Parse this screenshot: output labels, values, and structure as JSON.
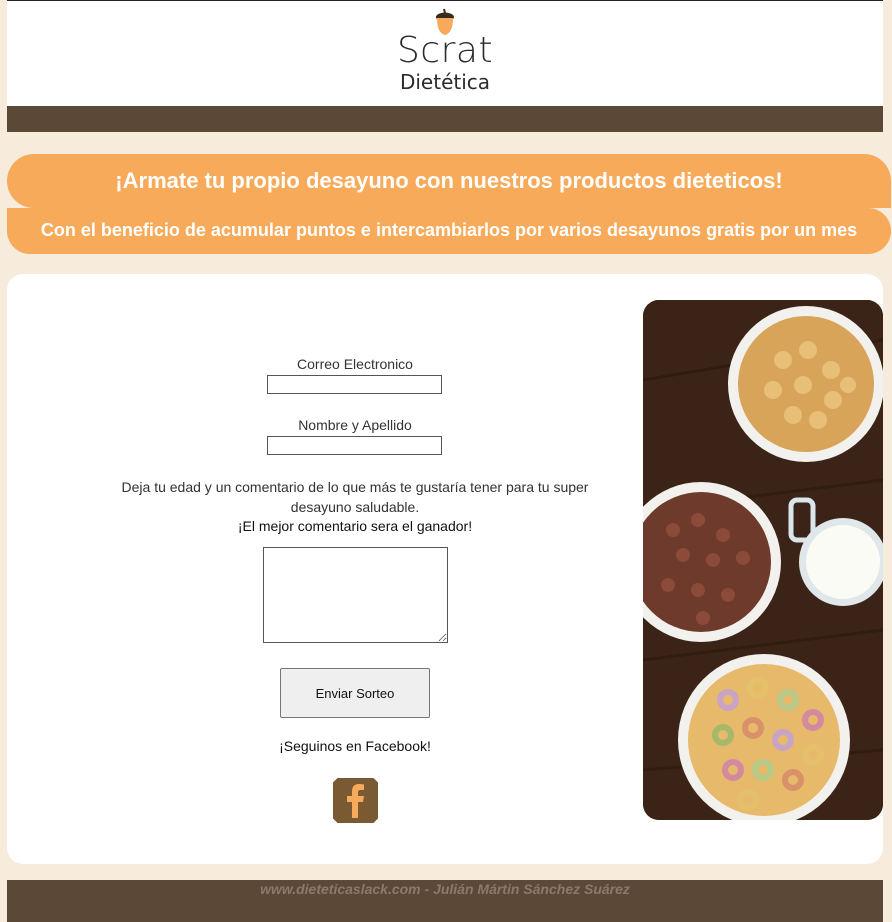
{
  "brand": {
    "name": "Scrat",
    "subtitle": "Dietética"
  },
  "banner": {
    "headline": "¡Armate tu propio desayuno con nuestros productos dieteticos!",
    "subheadline": "Con el beneficio de acumular puntos e intercambiarlos por varios desayunos gratis por un mes"
  },
  "form": {
    "email_label": "Correo Electronico",
    "email_value": "",
    "name_label": "Nombre y Apellido",
    "name_value": "",
    "description": "Deja tu edad y un comentario de lo que más te gustaría tener para tu super desayuno saludable.",
    "winner_note": "¡El mejor comentario sera el ganador!",
    "comment_value": "",
    "submit_label": "Enviar Sorteo",
    "facebook_text": "¡Seguinos en Facebook!"
  },
  "footer": {
    "text": "www.dieteticaslack.com - Julián Mártin Sánchez Suárez"
  },
  "colors": {
    "accent": "#f7aa5a",
    "brown": "#5c4836",
    "background": "#f7ebdc",
    "facebook_icon": "#7a5a33"
  },
  "icons": {
    "logo": "acorn-icon",
    "social": "facebook-icon"
  }
}
